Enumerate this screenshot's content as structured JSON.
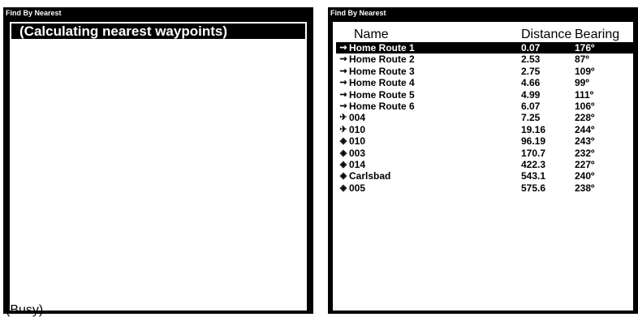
{
  "left": {
    "title": "Find By Nearest",
    "calculating": "(Calculating nearest waypoints)",
    "status": "(Busy)"
  },
  "right": {
    "title": "Find By Nearest",
    "headers": {
      "name": "Name",
      "distance": "Distance",
      "bearing": "Bearing"
    },
    "rows": [
      {
        "icon": "route-icon",
        "glyph": "⇝",
        "name": "Home Route 1",
        "distance": "0.07",
        "bearing": "176º",
        "selected": true
      },
      {
        "icon": "route-icon",
        "glyph": "⇝",
        "name": "Home Route 2",
        "distance": "2.53",
        "bearing": "87º"
      },
      {
        "icon": "route-icon",
        "glyph": "⇝",
        "name": "Home Route 3",
        "distance": "2.75",
        "bearing": "109º"
      },
      {
        "icon": "route-icon",
        "glyph": "⇝",
        "name": "Home Route 4",
        "distance": "4.66",
        "bearing": "99º"
      },
      {
        "icon": "route-icon",
        "glyph": "⇝",
        "name": "Home Route 5",
        "distance": "4.99",
        "bearing": "111º"
      },
      {
        "icon": "route-icon",
        "glyph": "⇝",
        "name": "Home Route 6",
        "distance": "6.07",
        "bearing": "106º"
      },
      {
        "icon": "airport-icon",
        "glyph": "✈",
        "name": "004",
        "distance": "7.25",
        "bearing": "228º"
      },
      {
        "icon": "airport-icon",
        "glyph": "✈",
        "name": "010",
        "distance": "19.16",
        "bearing": "244º"
      },
      {
        "icon": "waypoint-icon",
        "glyph": "◈",
        "name": "010",
        "distance": "96.19",
        "bearing": "243º"
      },
      {
        "icon": "waypoint-icon",
        "glyph": "◈",
        "name": "003",
        "distance": "170.7",
        "bearing": "232º"
      },
      {
        "icon": "waypoint-icon",
        "glyph": "◈",
        "name": "014",
        "distance": "422.3",
        "bearing": "227º"
      },
      {
        "icon": "waypoint-icon",
        "glyph": "◈",
        "name": "Carlsbad",
        "distance": "543.1",
        "bearing": "240º"
      },
      {
        "icon": "waypoint-icon",
        "glyph": "◈",
        "name": "005",
        "distance": "575.6",
        "bearing": "238º"
      }
    ]
  }
}
